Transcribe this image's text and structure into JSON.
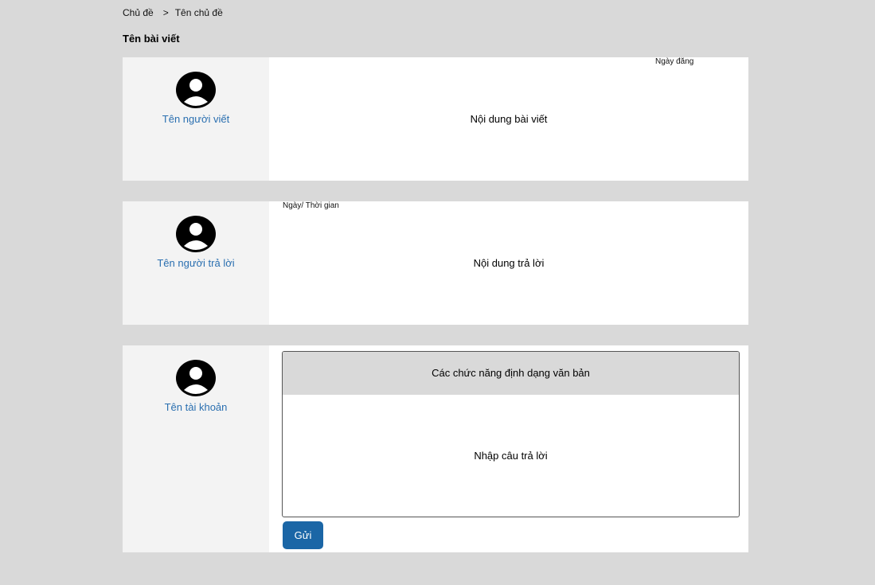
{
  "breadcrumb": {
    "root": "Chủ đề",
    "separator": ">",
    "current": "Tên chủ đề"
  },
  "post": {
    "title": "Tên bài viết",
    "author": "Tên người viết",
    "date_label": "Ngày đăng",
    "content": "Nội dung bài viết"
  },
  "reply": {
    "author": "Tên người trả lời",
    "datetime_label": "Ngày/ Thời gian",
    "content": "Nội dung trả lời"
  },
  "compose": {
    "account": "Tên tài khoản",
    "toolbar_label": "Các chức năng định dạng văn bản",
    "input_placeholder": "Nhập câu trả lời",
    "send_label": "Gửi"
  },
  "icons": {
    "avatar": "user-circle-icon"
  },
  "colors": {
    "background": "#d9d9d9",
    "sidebar": "#f3f3f3",
    "link": "#2a6fb0",
    "button": "#1b66a6"
  }
}
